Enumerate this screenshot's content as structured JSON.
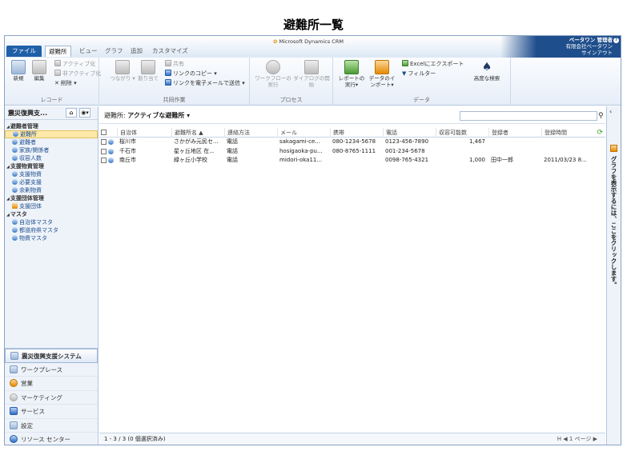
{
  "page_title": "避難所一覧",
  "tabs": [
    {
      "label": "ファイル"
    },
    {
      "label": "避難所"
    },
    {
      "label": "ビュー"
    },
    {
      "label": "グラフ"
    },
    {
      "label": "追加"
    },
    {
      "label": "カスタマイズ"
    }
  ],
  "crm_logo": "Microsoft Dynamics CRM",
  "user": {
    "name": "ベータワン 管理者",
    "org": "有限会社ベータワン",
    "signout": "サインアウト"
  },
  "ribbon": {
    "record": {
      "label": "レコード",
      "new": "新規",
      "edit": "編集",
      "activate": "アクティブ化",
      "deactivate": "非アクティブ化",
      "delete": "削除 ▾"
    },
    "collab": {
      "label": "共同作業",
      "connect": "つながり ▾",
      "assign": "割り当て",
      "share": "共有",
      "copy_link": "リンクのコピー ▾",
      "email_link": "リンクを電子メールで送信 ▾"
    },
    "process": {
      "label": "プロセス",
      "workflow": "ワークフローの実行",
      "dialog": "ダイアログの開始"
    },
    "data": {
      "label": "データ",
      "report": "レポートの実行▾",
      "import": "データのインポート▾",
      "excel": "Excelにエクスポート",
      "filter": "フィルター",
      "advfind": "高度な検索"
    }
  },
  "left_nav": {
    "title": "震災復興支...",
    "groups": [
      {
        "label": "避難者管理",
        "items": [
          "避難所",
          "避難者",
          "家族/関係者",
          "収容人数"
        ]
      },
      {
        "label": "支援物資管理",
        "items": [
          "支援物資",
          "必要支援",
          "余剰物資"
        ]
      },
      {
        "label": "支援団体管理",
        "items": [
          "支援団体"
        ]
      },
      {
        "label": "マスタ",
        "items": [
          "自治体マスタ",
          "都道府県マスタ",
          "物資マスタ"
        ]
      }
    ],
    "areas": [
      "震災復興支援システム",
      "ワークプレース",
      "営業",
      "マーケティング",
      "サービス",
      "設定",
      "リソース センター"
    ]
  },
  "view": {
    "label": "避難所:",
    "name": "アクティブな避難所 ▾",
    "search_placeholder": ""
  },
  "grid": {
    "columns": [
      "自治体",
      "避難所名 ▲",
      "連絡方法",
      "メール",
      "携帯",
      "電話",
      "収容可能数",
      "登録者",
      "登録時間"
    ],
    "rows": [
      [
        "桜川市",
        "さかがみ元民セ...",
        "電話",
        "sakagami-ce...",
        "080-1234-5678",
        "0123-456-7890",
        "1,467",
        "",
        ""
      ],
      [
        "千石市",
        "星ヶ丘地区 在...",
        "電話",
        "hosigaoka-pu...",
        "080-8765-1111",
        "001-234-5678",
        "",
        "",
        ""
      ],
      [
        "南丘市",
        "緑ヶ丘小学校",
        "電話",
        "midori-oka11...",
        "",
        "0098-765-4321",
        "1,000",
        "田中一郎",
        "2011/03/23 8..."
      ]
    ]
  },
  "footer": {
    "count": "1 - 3 / 3 (0 個選択済み)",
    "pager": "H ◀ 1 ページ ▶"
  },
  "right_panel": {
    "text": "グラフを表示するには、ここをクリックします。"
  }
}
